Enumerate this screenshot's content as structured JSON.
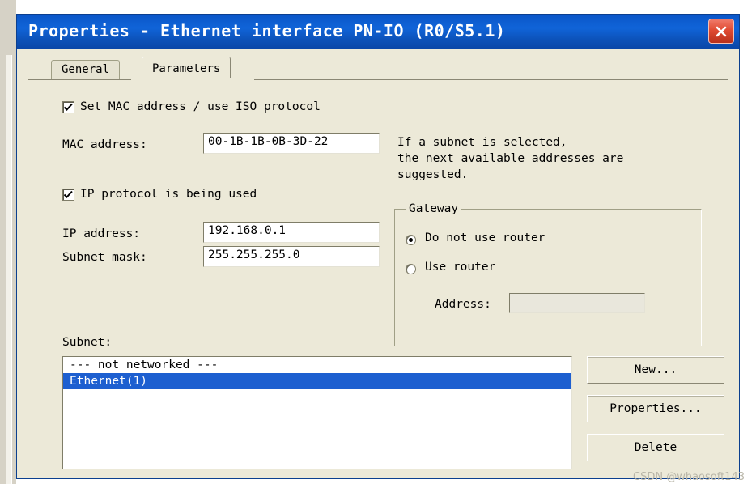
{
  "window": {
    "title": "Properties - Ethernet interface  PN-IO  (R0/S5.1)",
    "close_icon": "close-icon"
  },
  "tabs": [
    {
      "label": "General",
      "active": false
    },
    {
      "label": "Parameters",
      "active": true
    }
  ],
  "form": {
    "mac_checkbox": {
      "label": "Set MAC address / use ISO protocol",
      "checked": true
    },
    "mac_address": {
      "label": "MAC address:",
      "value": "00-1B-1B-0B-3D-22"
    },
    "ip_checkbox": {
      "label": "IP protocol is being used",
      "checked": true
    },
    "ip_address": {
      "label": "IP address:",
      "value": "192.168.0.1"
    },
    "subnet_mask": {
      "label": "Subnet mask:",
      "value": "255.255.255.0"
    },
    "hint": "If a subnet is selected,\nthe next available addresses are\nsuggested."
  },
  "gateway": {
    "title": "Gateway",
    "options": [
      {
        "label": "Do not use router",
        "selected": true
      },
      {
        "label": "Use router",
        "selected": false
      }
    ],
    "address": {
      "label": "Address:",
      "value": ""
    }
  },
  "subnet": {
    "label": "Subnet:",
    "items": [
      {
        "text": "--- not networked ---",
        "selected": false
      },
      {
        "text": "Ethernet(1)",
        "selected": true
      }
    ]
  },
  "buttons": {
    "new": "New...",
    "properties": "Properties...",
    "delete": "Delete"
  },
  "watermark": "CSDN @whaosoft143",
  "colors": {
    "title_bar": "#0d5ad0",
    "dialog_face": "#ece9d8",
    "selection": "#1d5fd0",
    "close_button": "#d8432a"
  }
}
